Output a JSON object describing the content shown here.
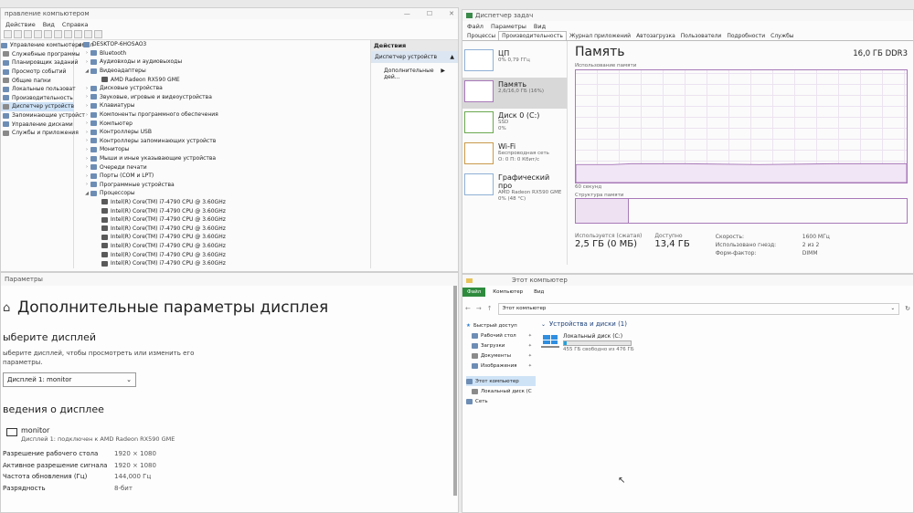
{
  "devmgr": {
    "title": "правление компьютером",
    "menu": [
      "Действие",
      "Вид",
      "Справка"
    ],
    "left_tree": [
      "Управление компьютером (л",
      "Служебные программы",
      "Планировщик заданий",
      "Просмотр событий",
      "Общие папки",
      "Локальные пользоват",
      "Производительность",
      "Диспетчер устройств",
      "Запоминающие устройст",
      "Управление дисками",
      "Службы и приложения"
    ],
    "root": "DESKTOP-6HOSAO3",
    "devices": [
      {
        "label": "Bluetooth",
        "level": 1,
        "expanded": false
      },
      {
        "label": "Аудиовходы и аудиовыходы",
        "level": 1,
        "expanded": false
      },
      {
        "label": "Видеоадаптеры",
        "level": 1,
        "expanded": true
      },
      {
        "label": "AMD Radeon RX590 GME",
        "level": 2
      },
      {
        "label": "Дисковые устройства",
        "level": 1,
        "expanded": false
      },
      {
        "label": "Звуковые, игровые и видеоустройства",
        "level": 1,
        "expanded": false
      },
      {
        "label": "Клавиатуры",
        "level": 1,
        "expanded": false
      },
      {
        "label": "Компоненты программного обеспечения",
        "level": 1,
        "expanded": false
      },
      {
        "label": "Компьютер",
        "level": 1,
        "expanded": false
      },
      {
        "label": "Контроллеры USB",
        "level": 1,
        "expanded": false
      },
      {
        "label": "Контроллеры запоминающих устройств",
        "level": 1,
        "expanded": false
      },
      {
        "label": "Мониторы",
        "level": 1,
        "expanded": false
      },
      {
        "label": "Мыши и иные указывающие устройства",
        "level": 1,
        "expanded": false
      },
      {
        "label": "Очереди печати",
        "level": 1,
        "expanded": false
      },
      {
        "label": "Порты (COM и LPT)",
        "level": 1,
        "expanded": false
      },
      {
        "label": "Программные устройства",
        "level": 1,
        "expanded": false
      },
      {
        "label": "Процессоры",
        "level": 1,
        "expanded": true
      },
      {
        "label": "Intel(R) Core(TM) i7-4790 CPU @ 3.60GHz",
        "level": 2
      },
      {
        "label": "Intel(R) Core(TM) i7-4790 CPU @ 3.60GHz",
        "level": 2
      },
      {
        "label": "Intel(R) Core(TM) i7-4790 CPU @ 3.60GHz",
        "level": 2
      },
      {
        "label": "Intel(R) Core(TM) i7-4790 CPU @ 3.60GHz",
        "level": 2
      },
      {
        "label": "Intel(R) Core(TM) i7-4790 CPU @ 3.60GHz",
        "level": 2
      },
      {
        "label": "Intel(R) Core(TM) i7-4790 CPU @ 3.60GHz",
        "level": 2
      },
      {
        "label": "Intel(R) Core(TM) i7-4790 CPU @ 3.60GHz",
        "level": 2
      },
      {
        "label": "Intel(R) Core(TM) i7-4790 CPU @ 3.60GHz",
        "level": 2
      }
    ],
    "actions_header": "Действия",
    "actions": [
      "Диспетчер устройств",
      "Дополнительные дей..."
    ]
  },
  "taskmgr": {
    "title": "Диспетчер задач",
    "menu": [
      "Файл",
      "Параметры",
      "Вид"
    ],
    "tabs": [
      "Процессы",
      "Производительность",
      "Журнал приложений",
      "Автозагрузка",
      "Пользователи",
      "Подробности",
      "Службы"
    ],
    "perf_items": [
      {
        "name": "ЦП",
        "l2": "0% 0,79 ГГц",
        "l3": ""
      },
      {
        "name": "Память",
        "l2": "2,6/16,0 ГБ (16%)",
        "l3": ""
      },
      {
        "name": "Диск 0 (C:)",
        "l2": "SSD",
        "l3": "0%"
      },
      {
        "name": "Wi-Fi",
        "l2": "Беспроводная сеть",
        "l3": "О: 0 П: 0 Кбит/с"
      },
      {
        "name": "Графический про",
        "l2": "AMD Radeon RX590 GME",
        "l3": "0% (48 °C)"
      }
    ],
    "mem_title": "Память",
    "mem_total": "16,0 ГБ DDR3",
    "usage_label": "Использование памяти",
    "seconds_label": "60 секунд",
    "structure_label": "Структура памяти",
    "in_use_label": "Используется (сжатая)",
    "in_use_value": "2,5 ГБ (0 МБ)",
    "available_label": "Доступно",
    "available_value": "13,4 ГБ",
    "speed_label": "Скорость:",
    "speed_value": "1600 МГц",
    "slots_label": "Использовано гнезд:",
    "slots_value": "2 из 2",
    "form_label": "Форм-фактор:",
    "form_value": "DIMM"
  },
  "settings": {
    "window_title": "Параметры",
    "page_title": "Дополнительные параметры дисплея",
    "select_heading": "ыберите дисплей",
    "select_desc": "ыберите дисплей, чтобы просмотреть или изменить его параметры.",
    "dropdown_value": "Дисплей 1: monitor",
    "info_heading": "ведения о дисплее",
    "monitor_name": "monitor",
    "monitor_desc": "Дисплей 1: подключен к AMD Radeon RX590 GME",
    "rows": [
      {
        "label": "Разрешение рабочего стола",
        "value": "1920 × 1080"
      },
      {
        "label": "Активное разрешение сигнала",
        "value": "1920 × 1080"
      },
      {
        "label": "Частота обновления (Гц)",
        "value": "144,000 Гц"
      },
      {
        "label": "Разрядность",
        "value": "8-бит"
      }
    ]
  },
  "explorer": {
    "title": "Этот компьютер",
    "tabs": [
      "Файл",
      "Компьютер",
      "Вид"
    ],
    "address": "Этот компьютер",
    "quick_access": "Быстрый доступ",
    "sidebar": [
      "Рабочий стол",
      "Загрузки",
      "Документы",
      "Изображения"
    ],
    "this_pc": "Этот компьютер",
    "local_disk_nav": "Локальный диск (C",
    "network": "Сеть",
    "section": "Устройства и диски (1)",
    "disk_name": "Локальный диск (C:)",
    "disk_free": "455 ГБ свободно из 476 ГБ",
    "disk_used_fraction": 0.044
  },
  "colors": {
    "accent": "#4a8fd6",
    "green": "#2e8b3e",
    "mem_graph": "#a879b8"
  }
}
